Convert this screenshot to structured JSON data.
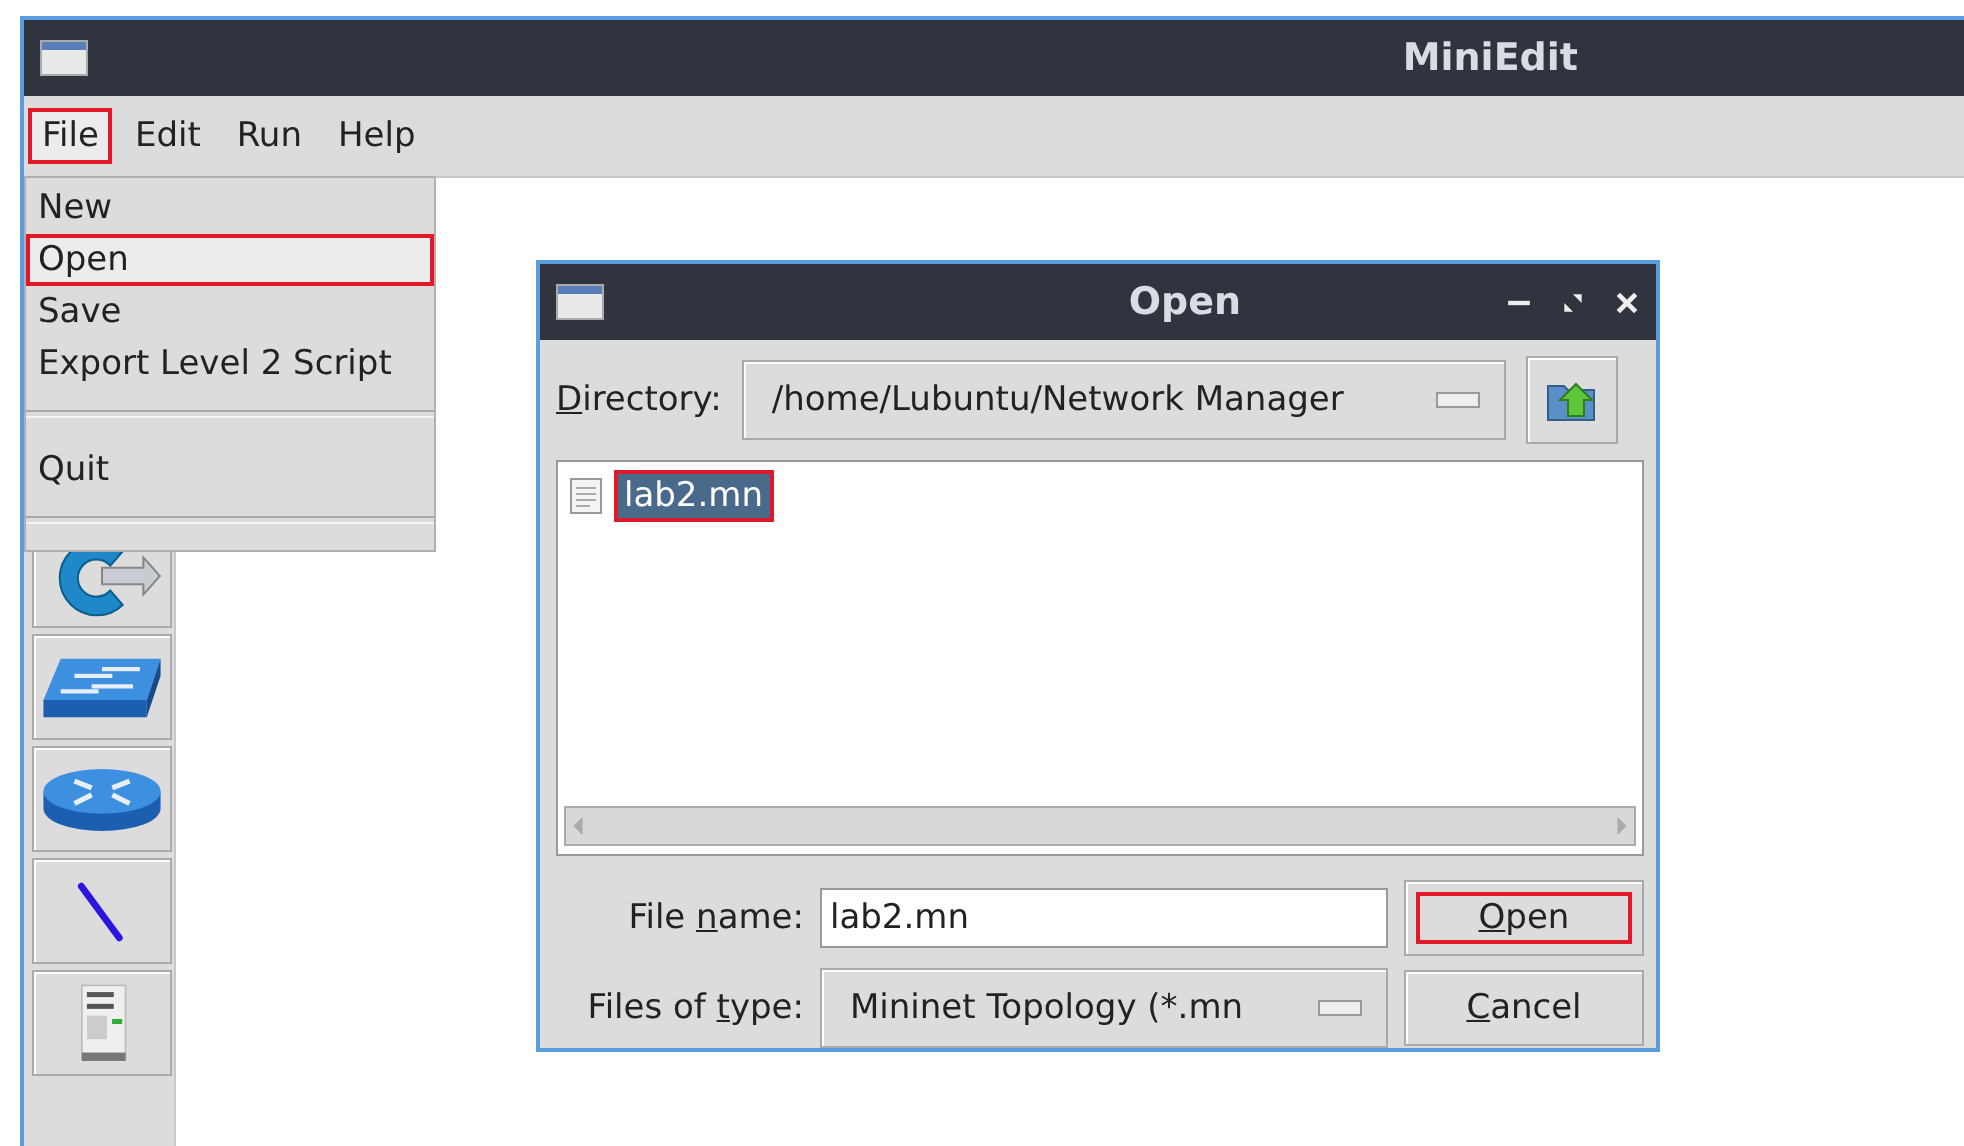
{
  "window": {
    "title": "MiniEdit"
  },
  "menubar": [
    {
      "label": "File",
      "highlighted": true,
      "selected": true
    },
    {
      "label": "Edit",
      "highlighted": false,
      "selected": false
    },
    {
      "label": "Run",
      "highlighted": false,
      "selected": false
    },
    {
      "label": "Help",
      "highlighted": false,
      "selected": false
    }
  ],
  "file_menu": [
    {
      "kind": "item",
      "label": "New",
      "highlighted": false
    },
    {
      "kind": "item",
      "label": "Open",
      "highlighted": true
    },
    {
      "kind": "item",
      "label": "Save",
      "highlighted": false
    },
    {
      "kind": "item",
      "label": "Export Level 2 Script",
      "highlighted": false
    },
    {
      "kind": "separator"
    },
    {
      "kind": "item",
      "label": "Quit",
      "highlighted": false
    },
    {
      "kind": "separator"
    }
  ],
  "toolbar": [
    {
      "kind": "controller"
    },
    {
      "kind": "switch"
    },
    {
      "kind": "router"
    },
    {
      "kind": "link"
    },
    {
      "kind": "host"
    }
  ],
  "dialog": {
    "title": "Open",
    "directory": {
      "label": {
        "key": "D",
        "post": "irectory:"
      },
      "value": "/home/Lubuntu/Network Manager"
    },
    "files": [
      {
        "name": "lab2.mn",
        "selected": true,
        "highlighted": true
      }
    ],
    "file_name": {
      "label": {
        "pre": "File ",
        "key": "n",
        "post": "ame:"
      },
      "value": "lab2.mn"
    },
    "file_type": {
      "label": {
        "pre": "Files of ",
        "key": "t",
        "post": "ype:"
      },
      "value": "Mininet Topology (*.mn"
    },
    "buttons": [
      {
        "label": {
          "key": "O",
          "post": "pen"
        },
        "highlighted": true
      },
      {
        "label": {
          "key": "C",
          "post": "ancel"
        },
        "highlighted": false
      }
    ]
  }
}
